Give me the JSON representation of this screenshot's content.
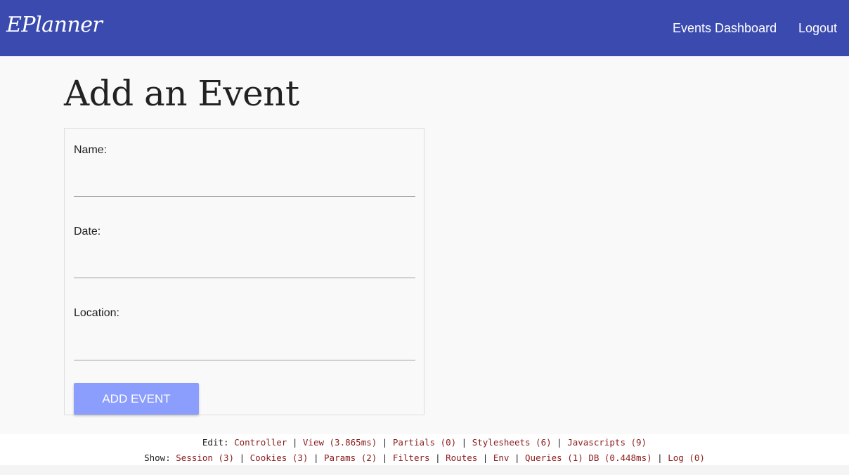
{
  "nav": {
    "brand": "EPlanner",
    "links": [
      {
        "label": "Events Dashboard"
      },
      {
        "label": "Logout"
      }
    ]
  },
  "page": {
    "title": "Add an Event"
  },
  "form": {
    "fields": [
      {
        "label": "Name:",
        "value": ""
      },
      {
        "label": "Date:",
        "value": ""
      },
      {
        "label": "Location:",
        "value": ""
      }
    ],
    "submit_label": "Add Event"
  },
  "debug": {
    "edit_prefix": "Edit:",
    "edit_links": [
      "Controller",
      "View (3.865ms)",
      "Partials (0)",
      "Stylesheets (6)",
      "Javascripts (9)"
    ],
    "show_prefix": "Show:",
    "show_links": [
      "Session (3)",
      "Cookies (3)",
      "Params (2)",
      "Filters",
      "Routes",
      "Env",
      "Queries (1) DB (0.448ms)",
      "Log (0)"
    ],
    "link_color": "#8b1a1a"
  },
  "colors": {
    "navbar": "#3a4aaf",
    "button": "#8b9dfd"
  }
}
